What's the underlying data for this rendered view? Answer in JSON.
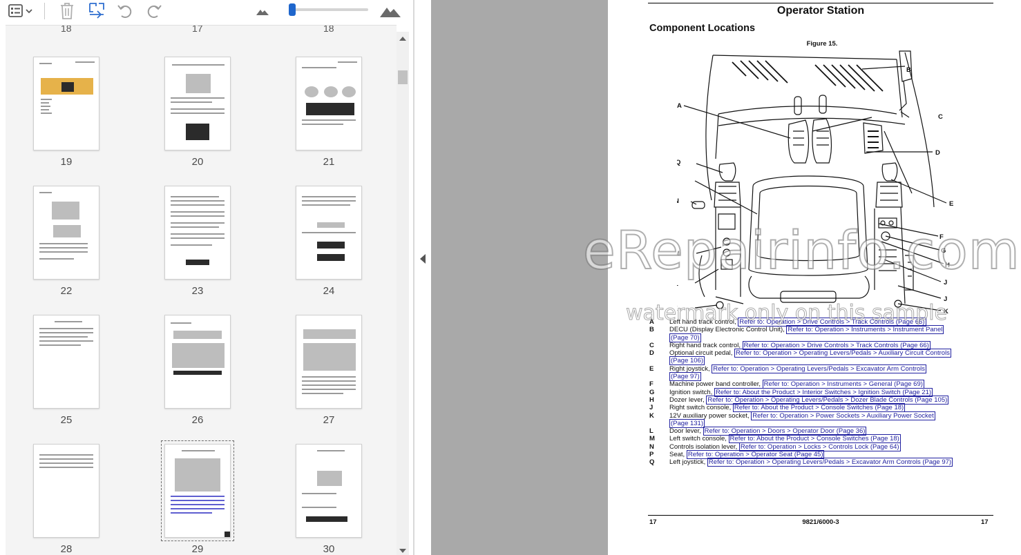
{
  "toolbar": {
    "view_icon": "list-view-icon",
    "delete_icon": "trash-icon",
    "extract_icon": "extract-pages-icon",
    "undo_icon": "rotate-left-icon",
    "redo_icon": "rotate-right-icon",
    "zoom_out_icon": "small-mountain-icon",
    "zoom_in_icon": "large-mountain-icon",
    "zoom_level": 0.03,
    "accent_color": "#1f66cc"
  },
  "thumbnails": {
    "cut_labels": [
      "18",
      "17",
      "18"
    ],
    "pages": [
      {
        "number": "19"
      },
      {
        "number": "20"
      },
      {
        "number": "21"
      },
      {
        "number": "22"
      },
      {
        "number": "23"
      },
      {
        "number": "24"
      },
      {
        "number": "25"
      },
      {
        "number": "26"
      },
      {
        "number": "27"
      },
      {
        "number": "28"
      },
      {
        "number": "29"
      },
      {
        "number": "30"
      }
    ],
    "selected_page": "29"
  },
  "document": {
    "title": "Operator Station",
    "section": "Component Locations",
    "figure_label": "Figure 15.",
    "callouts": [
      "A",
      "B",
      "C",
      "D",
      "E",
      "F",
      "G",
      "H",
      "J",
      "J",
      "K",
      "K",
      "L",
      "M",
      "N",
      "P",
      "Q"
    ],
    "legend": [
      {
        "letter": "A",
        "text": "Left hand track control, ",
        "link": "Refer to: Operation > Drive Controls > Track Controls (Page 66)",
        "link2": ""
      },
      {
        "letter": "B",
        "text": "DECU (Display Electronic Control Unit), ",
        "link": "Refer to: Operation > Instruments > Instrument Panel",
        "link2": "(Page 70)"
      },
      {
        "letter": "C",
        "text": "Right hand track control, ",
        "link": "Refer to: Operation > Drive Controls > Track Controls (Page 66)",
        "link2": ""
      },
      {
        "letter": "D",
        "text": "Optional circuit pedal, ",
        "link": "Refer to: Operation > Operating Levers/Pedals > Auxiliary Circuit Controls",
        "link2": "(Page 106)"
      },
      {
        "letter": "E",
        "text": "Right joystick, ",
        "link": "Refer to: Operation > Operating Levers/Pedals > Excavator Arm Controls",
        "link2": "(Page 97)"
      },
      {
        "letter": "F",
        "text": "Machine power band controller, ",
        "link": "Refer to: Operation > Instruments > General (Page 69)",
        "link2": ""
      },
      {
        "letter": "G",
        "text": "Ignition switch, ",
        "link": "Refer to: About the Product > Interior Switches > Ignition Switch (Page 21)",
        "link2": ""
      },
      {
        "letter": "H",
        "text": "Dozer lever, ",
        "link": "Refer to: Operation > Operating Levers/Pedals > Dozer Blade Controls (Page 105)",
        "link2": ""
      },
      {
        "letter": "J",
        "text": "Right switch console, ",
        "link": "Refer to: About the Product > Console Switches (Page 18)",
        "link2": ""
      },
      {
        "letter": "K",
        "text": "12V auxiliary power socket, ",
        "link": "Refer to: Operation > Power Sockets > Auxiliary Power Socket",
        "link2": "(Page 131)"
      },
      {
        "letter": "L",
        "text": "Door lever, ",
        "link": "Refer to: Operation > Doors > Operator Door (Page 36)",
        "link2": ""
      },
      {
        "letter": "M",
        "text": "Left switch console, ",
        "link": "Refer to: About the Product > Console Switches (Page 18)",
        "link2": ""
      },
      {
        "letter": "N",
        "text": "Controls isolation lever, ",
        "link": "Refer to: Operation > Locks > Controls Lock (Page 64)",
        "link2": ""
      },
      {
        "letter": "P",
        "text": "Seat, ",
        "link": "Refer to: Operation > Operator Seat (Page 45)",
        "link2": ""
      },
      {
        "letter": "Q",
        "text": "Left joystick, ",
        "link": "Refer to: Operation > Operating Levers/Pedals > Excavator Arm Controls (Page 97)",
        "link2": ""
      }
    ],
    "footer_left": "17",
    "footer_center": "9821/6000-3",
    "footer_right": "17",
    "watermark": "eRepairinfo.com",
    "watermark_sub": "watermark only on this sample"
  }
}
